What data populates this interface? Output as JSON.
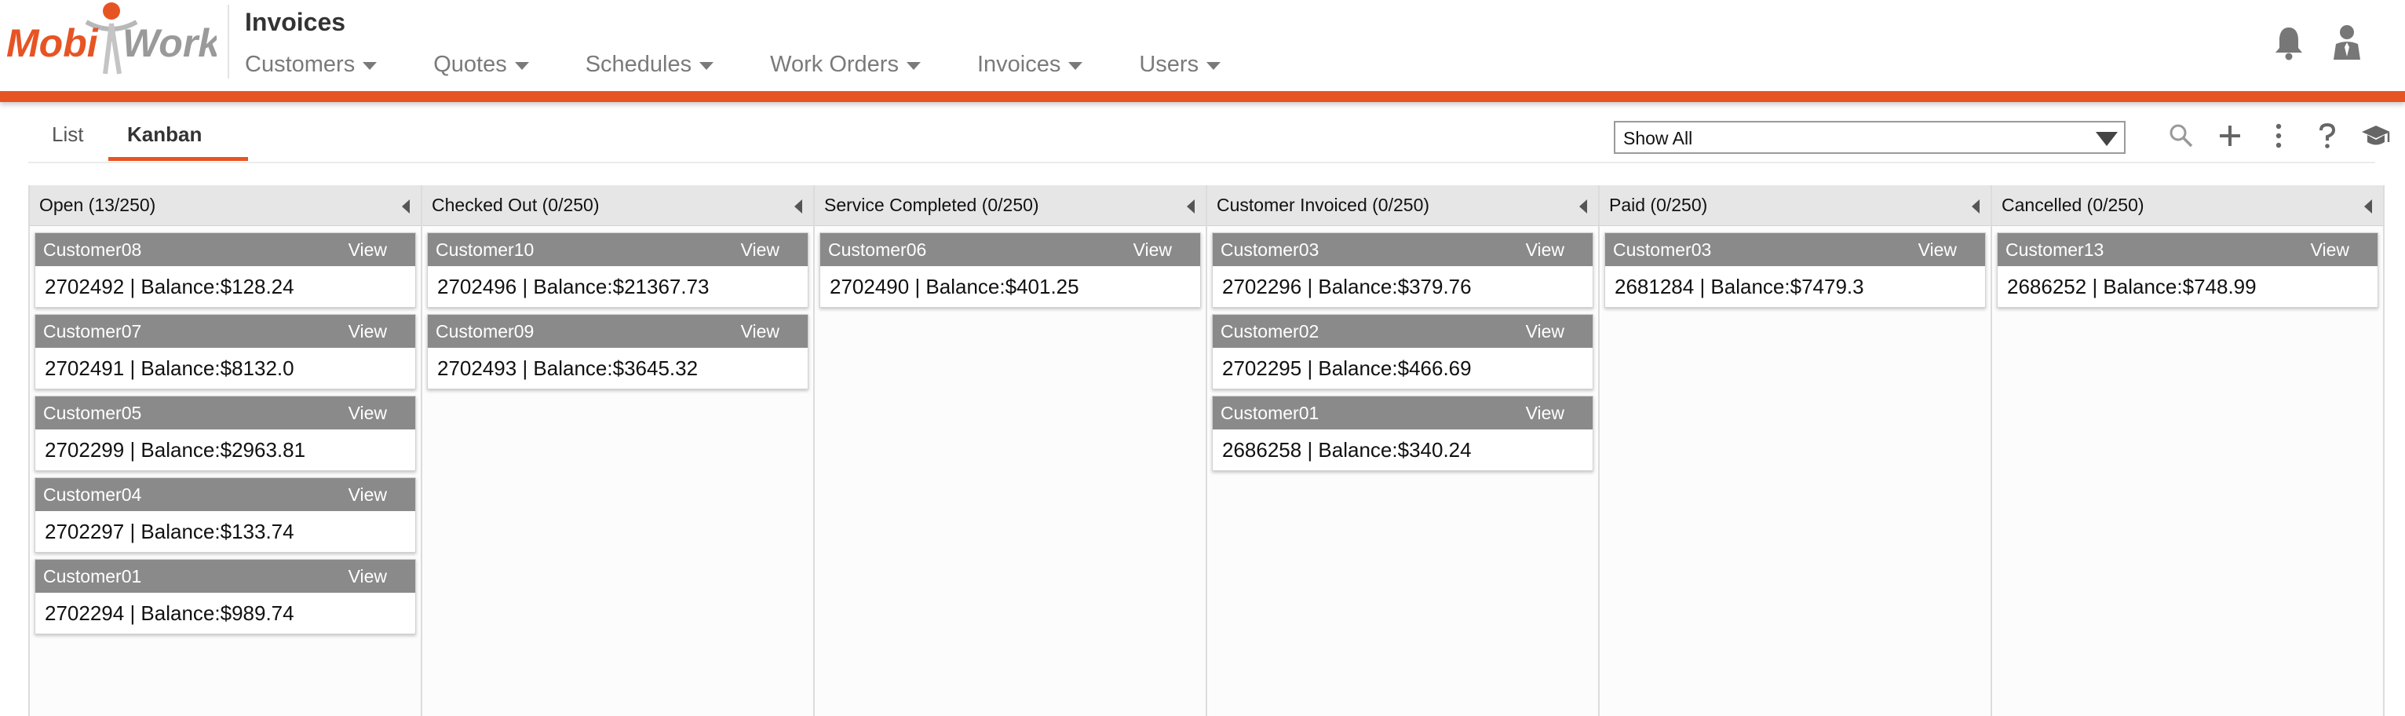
{
  "app": {
    "logo_text_left": "Mobi",
    "logo_text_right": "Work",
    "page_title": "Invoices",
    "brand_color": "#e75424"
  },
  "nav": {
    "items": [
      {
        "label": "Customers"
      },
      {
        "label": "Quotes"
      },
      {
        "label": "Schedules"
      },
      {
        "label": "Work Orders"
      },
      {
        "label": "Invoices"
      },
      {
        "label": "Users"
      }
    ]
  },
  "header_icons": [
    "bell-icon",
    "user-icon"
  ],
  "tabs": {
    "list": "List",
    "kanban": "Kanban",
    "active": "Kanban"
  },
  "filter": {
    "selected": "Show All"
  },
  "toolbar_icons": [
    "search-icon",
    "plus-icon",
    "more-vertical-icon",
    "help-icon",
    "graduation-cap-icon"
  ],
  "board": {
    "view_label": "View",
    "columns": [
      {
        "title": "Open (13/250)",
        "cards": [
          {
            "customer": "Customer08",
            "detail": "2702492 | Balance:$128.24"
          },
          {
            "customer": "Customer07",
            "detail": "2702491 | Balance:$8132.0"
          },
          {
            "customer": "Customer05",
            "detail": "2702299 | Balance:$2963.81"
          },
          {
            "customer": "Customer04",
            "detail": "2702297 | Balance:$133.74"
          },
          {
            "customer": "Customer01",
            "detail": "2702294 | Balance:$989.74"
          }
        ]
      },
      {
        "title": "Checked Out (0/250)",
        "cards": [
          {
            "customer": "Customer10",
            "detail": "2702496 | Balance:$21367.73"
          },
          {
            "customer": "Customer09",
            "detail": "2702493 | Balance:$3645.32"
          }
        ]
      },
      {
        "title": "Service Completed (0/250)",
        "cards": [
          {
            "customer": "Customer06",
            "detail": "2702490 | Balance:$401.25"
          }
        ]
      },
      {
        "title": "Customer Invoiced (0/250)",
        "cards": [
          {
            "customer": "Customer03",
            "detail": "2702296 | Balance:$379.76"
          },
          {
            "customer": "Customer02",
            "detail": "2702295 | Balance:$466.69"
          },
          {
            "customer": "Customer01",
            "detail": "2686258 | Balance:$340.24"
          }
        ]
      },
      {
        "title": "Paid (0/250)",
        "cards": [
          {
            "customer": "Customer03",
            "detail": "2681284 | Balance:$7479.3"
          }
        ]
      },
      {
        "title": "Cancelled (0/250)",
        "cards": [
          {
            "customer": "Customer13",
            "detail": "2686252 | Balance:$748.99"
          }
        ]
      }
    ]
  }
}
